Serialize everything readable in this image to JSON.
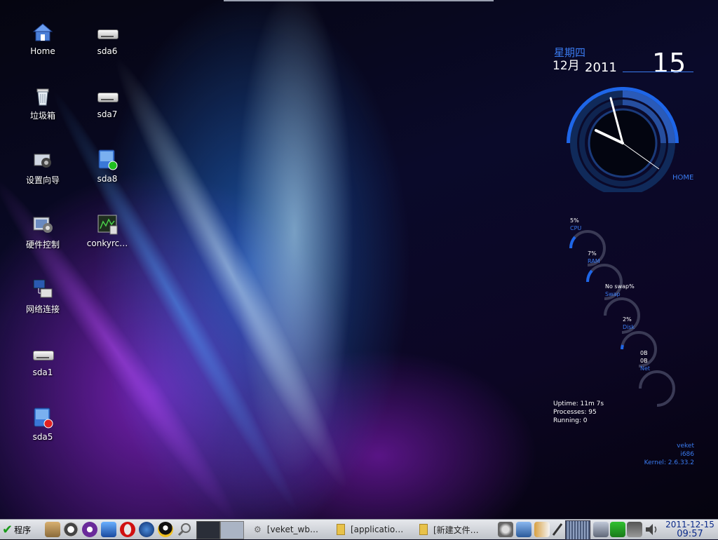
{
  "desktop": {
    "icons_left": [
      {
        "label": "Home",
        "icon": "home-folder-icon"
      },
      {
        "label": "垃圾箱",
        "icon": "trash-icon"
      },
      {
        "label": "设置向导",
        "icon": "setup-wizard-icon"
      },
      {
        "label": "硬件控制",
        "icon": "hardware-control-icon"
      },
      {
        "label": "网络连接",
        "icon": "network-connection-icon"
      },
      {
        "label": "sda1",
        "icon": "drive-icon"
      },
      {
        "label": "sda5",
        "icon": "drive-icon"
      }
    ],
    "icons_right": [
      {
        "label": "sda6",
        "icon": "drive-icon"
      },
      {
        "label": "sda7",
        "icon": "drive-icon"
      },
      {
        "label": "sda8",
        "icon": "drive-icon"
      },
      {
        "label": "conkyrc…",
        "icon": "text-file-icon"
      }
    ]
  },
  "conky": {
    "weekday": "星期四",
    "month": "12月",
    "year": "2011",
    "day": "15",
    "clock_label": "HOME",
    "accent": "#3a7bf0",
    "monitors": [
      {
        "value": "5%",
        "label": "CPU"
      },
      {
        "value": "7%",
        "label": "RAM"
      },
      {
        "value": "No swap%",
        "label": "Swap"
      },
      {
        "value": "2%",
        "label": "Disk"
      },
      {
        "value": "0B",
        "value2": "0B",
        "label": "Net"
      }
    ],
    "uptime": "Uptime: 11m 7s",
    "processes": "Processes: 95",
    "running": "Running: 0",
    "os": "veket",
    "arch": "i686",
    "kernel": "Kernel: 2.6.33.2"
  },
  "taskbar": {
    "start_label": "程序",
    "tasks": [
      {
        "label": "[veket_wb…"
      },
      {
        "label": "[applicatio…"
      },
      {
        "label": "[新建文件…"
      }
    ],
    "clock_date": "2011-12-15",
    "clock_time": "09:57"
  }
}
